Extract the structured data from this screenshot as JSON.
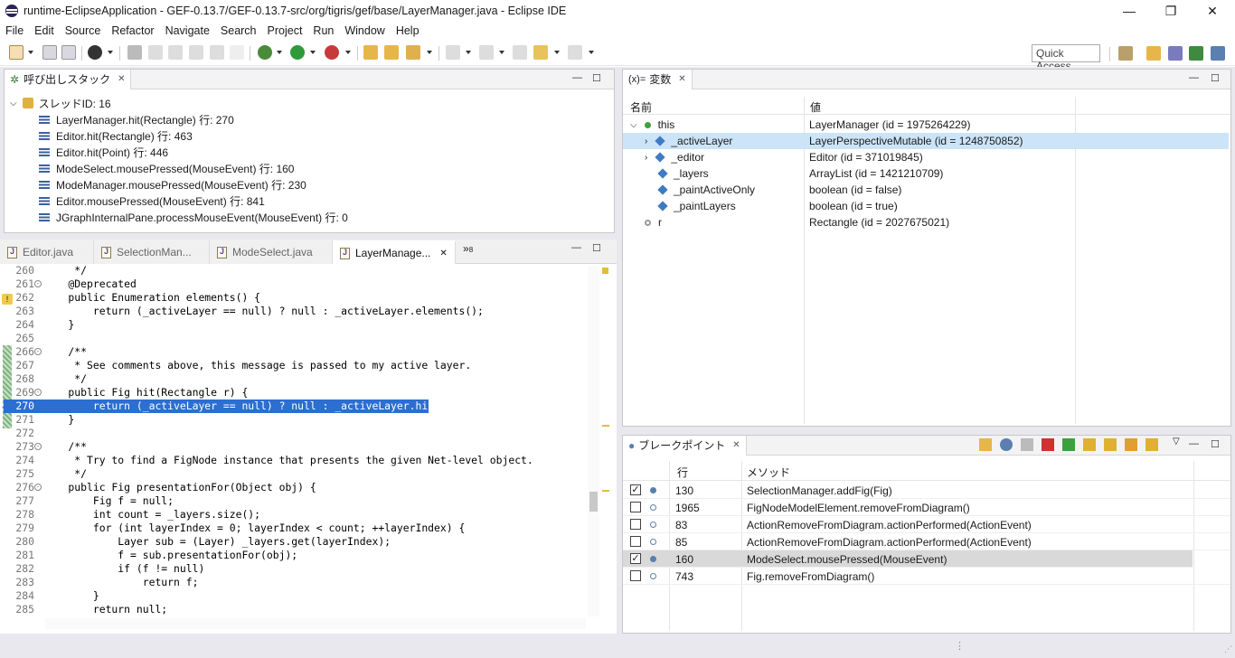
{
  "window": {
    "title": "runtime-EclipseApplication - GEF-0.13.7/GEF-0.13.7-src/org/tigris/gef/base/LayerManager.java - Eclipse IDE",
    "minimize": "—",
    "restore": "❐",
    "close": "✕"
  },
  "menu": [
    "File",
    "Edit",
    "Source",
    "Refactor",
    "Navigate",
    "Search",
    "Project",
    "Run",
    "Window",
    "Help"
  ],
  "quick_access": "Quick Access",
  "callstack": {
    "tab": "呼び出しスタック",
    "thread": "スレッドID: 16",
    "frames": [
      "LayerManager.hit(Rectangle) 行: 270",
      "Editor.hit(Rectangle) 行: 463",
      "Editor.hit(Point) 行: 446",
      "ModeSelect.mousePressed(MouseEvent) 行: 160",
      "ModeManager.mousePressed(MouseEvent) 行: 230",
      "Editor.mousePressed(MouseEvent) 行: 841",
      "JGraphInternalPane.processMouseEvent(MouseEvent) 行: 0"
    ]
  },
  "editor": {
    "tabs": [
      "Editor.java",
      "SelectionMan...",
      "ModeSelect.java",
      "LayerManage..."
    ],
    "more": "»",
    "more_count": "8",
    "lines": [
      {
        "n": "260",
        "t": "     */"
      },
      {
        "n": "261",
        "t": "    @Deprecated"
      },
      {
        "n": "262",
        "t": "    public Enumeration elements() {"
      },
      {
        "n": "263",
        "t": "        return (_activeLayer == null) ? null : _activeLayer.elements();"
      },
      {
        "n": "264",
        "t": "    }"
      },
      {
        "n": "265",
        "t": ""
      },
      {
        "n": "266",
        "t": "    /**"
      },
      {
        "n": "267",
        "t": "     * See comments above, this message is passed to my active layer."
      },
      {
        "n": "268",
        "t": "     */"
      },
      {
        "n": "269",
        "t": "    public Fig hit(Rectangle r) {"
      },
      {
        "n": "270",
        "t": "        return (_activeLayer == null) ? null : _activeLayer.hit(r);"
      },
      {
        "n": "271",
        "t": "    }"
      },
      {
        "n": "272",
        "t": ""
      },
      {
        "n": "273",
        "t": "    /**"
      },
      {
        "n": "274",
        "t": "     * Try to find a FigNode instance that presents the given Net-level object."
      },
      {
        "n": "275",
        "t": "     */"
      },
      {
        "n": "276",
        "t": "    public Fig presentationFor(Object obj) {"
      },
      {
        "n": "277",
        "t": "        Fig f = null;"
      },
      {
        "n": "278",
        "t": "        int count = _layers.size();"
      },
      {
        "n": "279",
        "t": "        for (int layerIndex = 0; layerIndex < count; ++layerIndex) {"
      },
      {
        "n": "280",
        "t": "            Layer sub = (Layer) _layers.get(layerIndex);"
      },
      {
        "n": "281",
        "t": "            f = sub.presentationFor(obj);"
      },
      {
        "n": "282",
        "t": "            if (f != null)"
      },
      {
        "n": "283",
        "t": "                return f;"
      },
      {
        "n": "284",
        "t": "        }"
      },
      {
        "n": "285",
        "t": "        return null;"
      }
    ]
  },
  "variables": {
    "tab": "変数",
    "tab_prefix": "(x)=",
    "col_name": "名前",
    "col_value": "値",
    "rows": [
      {
        "name": "this",
        "value": "LayerManager (id = 1975264229)"
      },
      {
        "name": "_activeLayer",
        "value": "LayerPerspectiveMutable (id = 1248750852)"
      },
      {
        "name": "_editor",
        "value": "Editor (id = 371019845)"
      },
      {
        "name": "_layers",
        "value": "ArrayList (id = 1421210709)"
      },
      {
        "name": "_paintActiveOnly",
        "value": "boolean (id = false)"
      },
      {
        "name": "_paintLayers",
        "value": "boolean (id = true)"
      },
      {
        "name": "r",
        "value": "Rectangle (id = 2027675021)"
      }
    ]
  },
  "breakpoints": {
    "tab": "ブレークポイント",
    "col_line": "行",
    "col_method": "メソッド",
    "rows": [
      {
        "line": "130",
        "method": "SelectionManager.addFig(Fig)",
        "checked": true
      },
      {
        "line": "1965",
        "method": "FigNodeModelElement.removeFromDiagram()",
        "checked": false
      },
      {
        "line": "83",
        "method": "ActionRemoveFromDiagram.actionPerformed(ActionEvent)",
        "checked": false
      },
      {
        "line": "85",
        "method": "ActionRemoveFromDiagram.actionPerformed(ActionEvent)",
        "checked": false
      },
      {
        "line": "160",
        "method": "ModeSelect.mousePressed(MouseEvent)",
        "checked": true
      },
      {
        "line": "743",
        "method": "Fig.removeFromDiagram()",
        "checked": false
      }
    ]
  },
  "colors": {
    "selection": "#2c6ed1",
    "var_selected": "#cce4f7",
    "bp_selected": "#d9d9d9"
  }
}
